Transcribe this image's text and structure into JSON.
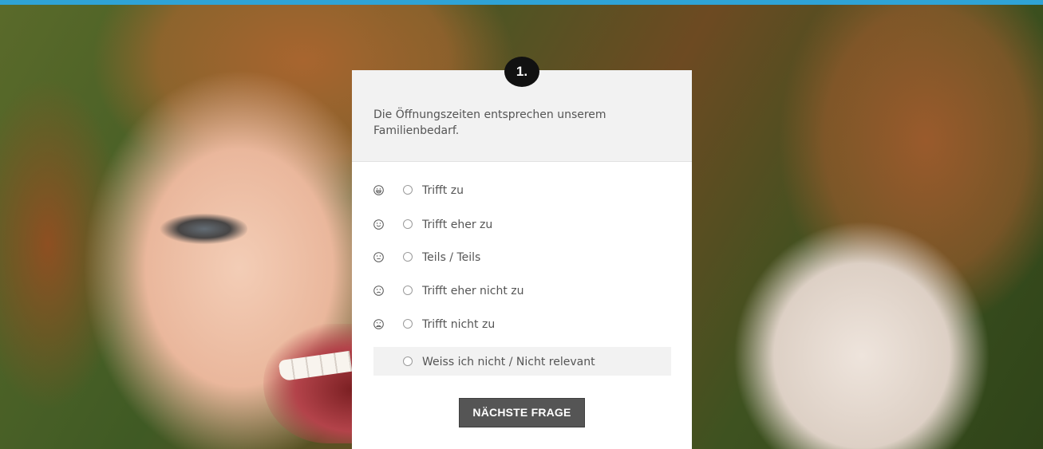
{
  "colors": {
    "top_bar": "#2fa3d6",
    "card_background": "#ffffff",
    "header_background": "#f2f2f2",
    "text": "#555555",
    "badge_background": "#111111",
    "button_background": "#555555"
  },
  "question": {
    "number": "1.",
    "text": "Die Öffnungszeiten entsprechen unserem Familienbedarf."
  },
  "options": [
    {
      "icon": "very-happy-face-icon",
      "label": "Trifft zu"
    },
    {
      "icon": "happy-face-icon",
      "label": "Trifft eher zu"
    },
    {
      "icon": "neutral-face-icon",
      "label": "Teils / Teils"
    },
    {
      "icon": "sad-face-icon",
      "label": "Trifft eher nicht zu"
    },
    {
      "icon": "very-sad-face-icon",
      "label": "Trifft nicht zu"
    },
    {
      "icon": "",
      "label": "Weiss ich nicht / Nicht relevant"
    }
  ],
  "next_button": {
    "label": "NÄCHSTE FRAGE"
  }
}
